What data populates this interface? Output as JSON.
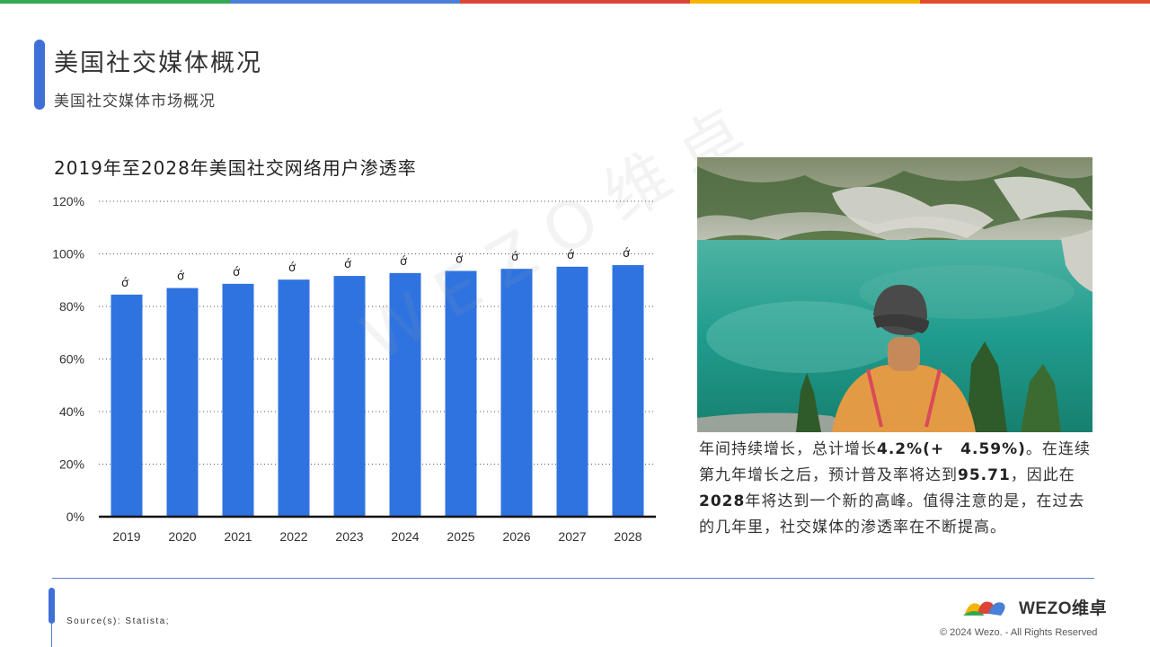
{
  "topbar_colors": [
    "#34a853",
    "#4a7fd8",
    "#dc4437",
    "#f4b400",
    "#e64a2e"
  ],
  "header": {
    "title": "美国社交媒体概况",
    "subtitle": "美国社交媒体市场概况"
  },
  "chart_title": "2019年至2028年美国社交网络用户渗透率",
  "chart_data": {
    "type": "bar",
    "categories": [
      "2019",
      "2020",
      "2021",
      "2022",
      "2023",
      "2024",
      "2025",
      "2026",
      "2027",
      "2028"
    ],
    "values": [
      84.5,
      87,
      88.6,
      90.2,
      91.6,
      92.7,
      93.5,
      94.3,
      95.1,
      95.71
    ],
    "data_labels": [
      "ớ",
      "ớ",
      "ớ",
      "ớ",
      "ớ",
      "ớ",
      "ớ",
      "ớ",
      "ớ",
      "ớ"
    ],
    "yticks": [
      "0%",
      "20%",
      "40%",
      "60%",
      "80%",
      "100%",
      "120%"
    ],
    "ylim": [
      0,
      120
    ],
    "bar_color": "#2f73e0",
    "grid": "dotted horizontal"
  },
  "watermark": "WEZO维卓",
  "description": {
    "p1": "年间持续增长，总计增长",
    "b1": "4.2%(+　4.59%)",
    "p2": "。在连续第九年增长之后，预计普及率将达到",
    "b2": "95.71",
    "p3": "，因此在",
    "b3": "2028",
    "p4": "年将达到一个新的高峰。值得注意的是，在过去的几年里，社交媒体的渗透率在不断提高。"
  },
  "footer": {
    "source": "Source(s): Statista;",
    "logo_text": "WEZO维卓",
    "copyright": "© 2024 Wezo. - All Rights Reserved"
  },
  "accent_color": "#3f70d6"
}
